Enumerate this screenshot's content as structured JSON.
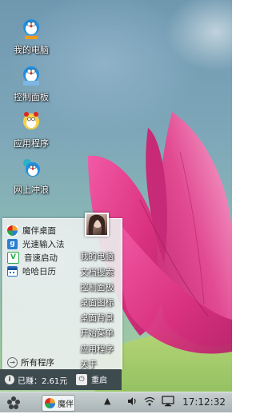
{
  "desktop_icons": [
    {
      "label": "我的电脑"
    },
    {
      "label": "控制面板"
    },
    {
      "label": "应用程序"
    },
    {
      "label": "网上冲浪"
    }
  ],
  "start_menu": {
    "apps": [
      {
        "label": "魔伴桌面",
        "icon": "pinwheel-icon",
        "color": "#f0a030"
      },
      {
        "label": "光速输入法",
        "icon": "g-keyboard-icon",
        "color": "#2a7fd4"
      },
      {
        "label": "音速启动",
        "icon": "v-launch-icon",
        "color": "#2aa84a"
      },
      {
        "label": "哈哈日历",
        "icon": "calendar-icon",
        "color": "#2a6fc0"
      }
    ],
    "all_programs": "所有程序",
    "right_links": [
      "我的电脑",
      "文档搜索",
      "控制面板",
      "桌面图标",
      "桌面背景",
      "开始菜单",
      "应用程序",
      "关于"
    ],
    "status": {
      "earned": "已赚：2.61元",
      "restart": "重启"
    }
  },
  "taskbar": {
    "item_label": "魔伴",
    "clock": "17:12:32",
    "tray_icons": [
      "arrow-up-icon",
      "volume-icon",
      "wifi-icon",
      "monitor-icon"
    ]
  }
}
